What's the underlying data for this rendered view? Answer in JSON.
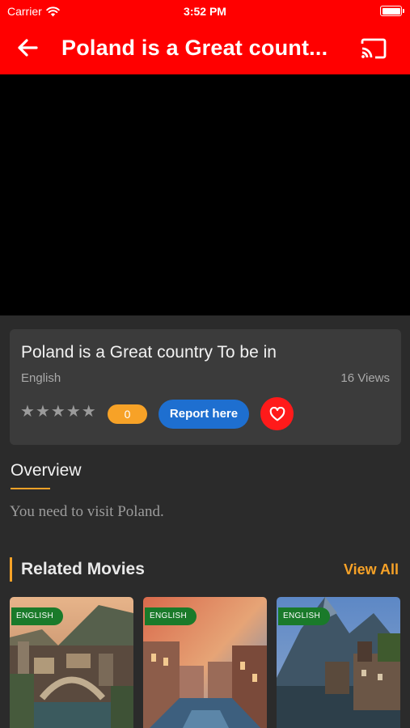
{
  "status_bar": {
    "carrier": "Carrier",
    "time": "3:52 PM"
  },
  "toolbar": {
    "title": "Poland is a Great count...",
    "back_icon": "arrow-left-icon",
    "cast_icon": "cast-icon"
  },
  "video": {
    "state": "black"
  },
  "movie_info": {
    "title": "Poland is a Great country To be in",
    "language": "English",
    "views": "16 Views",
    "stars": 5,
    "rating_value": "0",
    "report_label": "Report here",
    "favorite_icon": "heart-icon"
  },
  "overview": {
    "heading": "Overview",
    "text": "You need to visit Poland."
  },
  "related": {
    "heading": "Related Movies",
    "view_all": "View All",
    "items": [
      {
        "language": "ENGLISH"
      },
      {
        "language": "ENGLISH"
      },
      {
        "language": "ENGLISH"
      }
    ]
  },
  "colors": {
    "accent_red": "#ff0000",
    "accent_orange": "#f7a227",
    "report_blue": "#1e6fd0",
    "badge_green": "#1a7a2a",
    "background": "#2b2b2b",
    "card": "#3b3b3b"
  }
}
